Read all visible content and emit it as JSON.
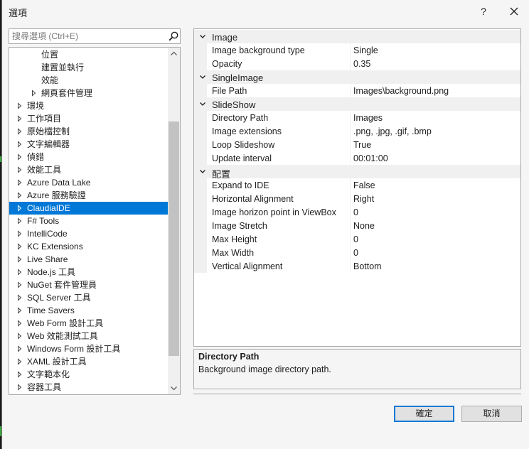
{
  "window": {
    "title": "選項",
    "help_label": "?"
  },
  "search": {
    "placeholder": "搜尋選項 (Ctrl+E)",
    "value": ""
  },
  "tree": {
    "items": [
      {
        "label": "位置",
        "level": 2,
        "expander": false,
        "selected": false
      },
      {
        "label": "建置並執行",
        "level": 2,
        "expander": false,
        "selected": false
      },
      {
        "label": "效能",
        "level": 2,
        "expander": false,
        "selected": false
      },
      {
        "label": "網頁套件管理",
        "level": 1,
        "expander": true,
        "selected": false
      },
      {
        "label": "環境",
        "level": 0,
        "expander": true,
        "selected": false
      },
      {
        "label": "工作項目",
        "level": 0,
        "expander": true,
        "selected": false
      },
      {
        "label": "原始檔控制",
        "level": 0,
        "expander": true,
        "selected": false
      },
      {
        "label": "文字編輯器",
        "level": 0,
        "expander": true,
        "selected": false
      },
      {
        "label": "偵錯",
        "level": 0,
        "expander": true,
        "selected": false
      },
      {
        "label": "效能工具",
        "level": 0,
        "expander": true,
        "selected": false
      },
      {
        "label": "Azure Data Lake",
        "level": 0,
        "expander": true,
        "selected": false
      },
      {
        "label": "Azure 服務驗證",
        "level": 0,
        "expander": true,
        "selected": false
      },
      {
        "label": "ClaudiaIDE",
        "level": 0,
        "expander": true,
        "selected": true
      },
      {
        "label": "F# Tools",
        "level": 0,
        "expander": true,
        "selected": false
      },
      {
        "label": "IntelliCode",
        "level": 0,
        "expander": true,
        "selected": false
      },
      {
        "label": "KC Extensions",
        "level": 0,
        "expander": true,
        "selected": false
      },
      {
        "label": "Live Share",
        "level": 0,
        "expander": true,
        "selected": false
      },
      {
        "label": "Node.js 工具",
        "level": 0,
        "expander": true,
        "selected": false
      },
      {
        "label": "NuGet 套件管理員",
        "level": 0,
        "expander": true,
        "selected": false
      },
      {
        "label": "SQL Server 工具",
        "level": 0,
        "expander": true,
        "selected": false
      },
      {
        "label": "Time Savers",
        "level": 0,
        "expander": true,
        "selected": false
      },
      {
        "label": "Web Form 設計工具",
        "level": 0,
        "expander": true,
        "selected": false
      },
      {
        "label": "Web 效能測試工具",
        "level": 0,
        "expander": true,
        "selected": false
      },
      {
        "label": "Windows Form 設計工具",
        "level": 0,
        "expander": true,
        "selected": false
      },
      {
        "label": "XAML 設計工具",
        "level": 0,
        "expander": true,
        "selected": false
      },
      {
        "label": "文字範本化",
        "level": 0,
        "expander": true,
        "selected": false
      },
      {
        "label": "容器工具",
        "level": 0,
        "expander": true,
        "selected": false
      }
    ]
  },
  "property_grid": {
    "categories": [
      {
        "name": "Image",
        "properties": [
          {
            "name": "Image background type",
            "value": "Single"
          },
          {
            "name": "Opacity",
            "value": "0.35"
          }
        ]
      },
      {
        "name": "SingleImage",
        "properties": [
          {
            "name": "File Path",
            "value": "Images\\background.png"
          }
        ]
      },
      {
        "name": "SlideShow",
        "properties": [
          {
            "name": "Directory Path",
            "value": "Images"
          },
          {
            "name": "Image extensions",
            "value": ".png, .jpg, .gif, .bmp"
          },
          {
            "name": "Loop Slideshow",
            "value": "True"
          },
          {
            "name": "Update interval",
            "value": "00:01:00"
          }
        ]
      },
      {
        "name": "配置",
        "properties": [
          {
            "name": "Expand to IDE",
            "value": "False"
          },
          {
            "name": "Horizontal Alignment",
            "value": "Right"
          },
          {
            "name": "Image horizon point in ViewBox",
            "value": "0"
          },
          {
            "name": "Image Stretch",
            "value": "None"
          },
          {
            "name": "Max Height",
            "value": "0"
          },
          {
            "name": "Max Width",
            "value": "0"
          },
          {
            "name": "Vertical Alignment",
            "value": "Bottom"
          }
        ]
      }
    ]
  },
  "description": {
    "title": "Directory Path",
    "text": "Background image directory path."
  },
  "buttons": {
    "ok_label": "確定",
    "cancel_label": "取消"
  },
  "colors": {
    "selection": "#0078d7",
    "dialog_bg": "#f5f5f5",
    "category_bg": "#f0f0f0",
    "border": "#a9a9a9"
  }
}
